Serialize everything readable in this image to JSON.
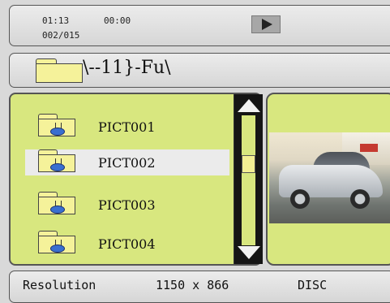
{
  "status": {
    "elapsed_time": "01:13",
    "total_time": "00:00",
    "track_counter": "002/015",
    "play_icon": "play-icon"
  },
  "path": {
    "folder_icon": "folder-icon",
    "text": "\\--11}-Fu\\"
  },
  "file_list": {
    "items": [
      {
        "label": "PICT001",
        "selected": false
      },
      {
        "label": "PICT002",
        "selected": true
      },
      {
        "label": "PICT003",
        "selected": false
      },
      {
        "label": "PICT004",
        "selected": false
      }
    ],
    "scroll_up_icon": "scroll-up-arrow-icon",
    "scroll_down_icon": "scroll-down-arrow-icon"
  },
  "preview": {
    "image": "car-photo-thumbnail"
  },
  "info": {
    "resolution_label": "Resolution",
    "resolution_value": "1150 x 866",
    "source": "DISC"
  },
  "colors": {
    "list_background": "#d8e77f",
    "folder_fill": "#f5f29a",
    "selection": "#ebebeb",
    "scrollbar": "#151515"
  }
}
